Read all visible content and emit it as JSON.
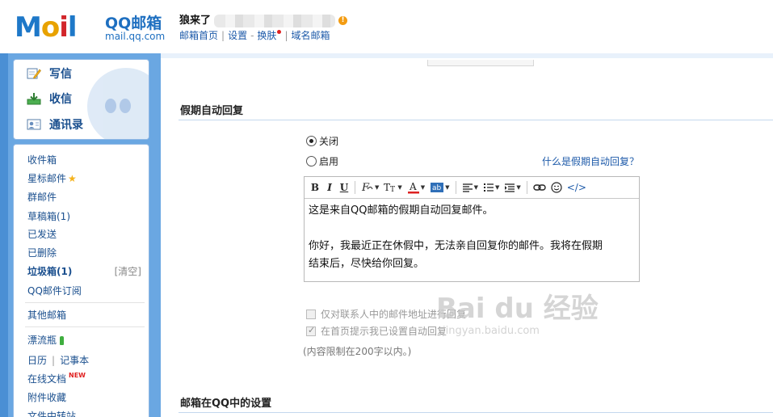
{
  "header": {
    "logo_text": "MOil",
    "logo_brand": "QQ邮箱",
    "logo_domain": "mail.qq.com",
    "username": "狼来了",
    "links": [
      "邮箱首页",
      "设置",
      "换肤",
      "域名邮箱"
    ],
    "link_sep_dash": "-"
  },
  "compose": {
    "items": [
      {
        "label": "写信",
        "icon": "pencil-paper-icon"
      },
      {
        "label": "收信",
        "icon": "inbox-download-icon"
      },
      {
        "label": "通讯录",
        "icon": "contact-card-icon"
      }
    ]
  },
  "folders": {
    "items": [
      {
        "label": "收件箱"
      },
      {
        "label": "星标邮件"
      },
      {
        "label": "群邮件"
      },
      {
        "label": "草稿箱(1)"
      },
      {
        "label": "已发送"
      },
      {
        "label": "已删除"
      },
      {
        "label": "垃圾箱(1)"
      },
      {
        "label": "QQ邮件订阅"
      },
      {
        "label": "其他邮箱"
      },
      {
        "label": "漂流瓶"
      },
      {
        "label": "日历"
      },
      {
        "label": "记事本"
      },
      {
        "label": "在线文档"
      },
      {
        "label": "附件收藏"
      },
      {
        "label": "文件中转站"
      }
    ],
    "clear_label": "[清空]",
    "new_badge": "NEW"
  },
  "settings": {
    "section_title": "假期自动回复",
    "radio_off": "关闭",
    "radio_on": "启用",
    "selected": "关闭",
    "help_link": "什么是假期自动回复？",
    "toolbar": {
      "bold": "B",
      "italic": "I",
      "underline": "U",
      "font": "F",
      "size": "T",
      "color": "A",
      "bg": "ab",
      "code": "</>"
    },
    "editor_text": [
      "这是来自QQ邮箱的假期自动回复邮件。",
      "你好，我最近正在休假中，无法亲自回复你的邮件。我将在假期",
      "结束后，尽快给你回复。"
    ],
    "check_contacts_only": "仅对联系人中的邮件地址进行回复",
    "check_show_home": "在首页提示我已设置自动回复",
    "limit_note": "(内容限制在200字以内。)",
    "section2_title": "邮箱在QQ中的设置"
  },
  "watermark": {
    "text": "Bai du 经验",
    "sub": "jingyan.baidu.com"
  },
  "colors": {
    "accent": "#1d5aa9",
    "left_panel": "#6aa7e2",
    "warn": "#f39c12"
  }
}
